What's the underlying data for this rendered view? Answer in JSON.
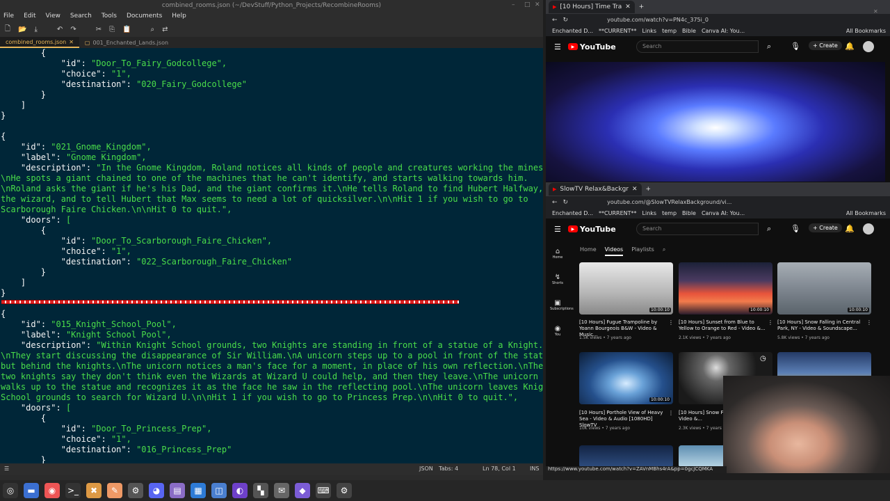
{
  "editor": {
    "title": "combined_rooms.json (~/DevStuff/Python_Projects/RecombineRooms)",
    "menu": [
      "File",
      "Edit",
      "View",
      "Search",
      "Tools",
      "Documents",
      "Help"
    ],
    "tabs": [
      {
        "label": "combined_rooms.json",
        "active": true
      },
      {
        "label": "001_Enchanted_Lands.json",
        "active": false
      }
    ],
    "code_lines": [
      "        {",
      "            \"id\": \"Door_To_Fairy_Godcollege\",",
      "            \"choice\": \"1\",",
      "            \"destination\": \"020_Fairy_Godcollege\"",
      "        }",
      "    ]",
      "}",
      "",
      "{",
      "    \"id\": \"021_Gnome_Kingdom\",",
      "    \"label\": \"Gnome Kingdom\",",
      "    \"description\": \"In the Gnome Kingdom, Roland notices all kinds of people and creatures working the mines.",
      "\\nHe spots a giant chained to one of the machines that he can't identify, and starts walking towards him.",
      "\\nRoland asks the giant if he's his Dad, and the giant confirms it.\\nHe tells Roland to find Hubert Halfway,",
      "the wizard, and to tell Hubert that Max seems to need a lot of quicksilver.\\n\\nHit 1 if you wish to go to",
      "Scarborough Faire Chicken.\\n\\nHit 0 to quit.\",",
      "    \"doors\": [",
      "        {",
      "            \"id\": \"Door_To_Scarborough_Faire_Chicken\",",
      "            \"choice\": \"1\",",
      "            \"destination\": \"022_Scarborough_Faire_Chicken\"",
      "        }",
      "    ]",
      "}",
      "",
      "{",
      "    \"id\": \"015_Knight_School_Pool\",",
      "    \"label\": \"Knight School Pool\",",
      "    \"description\": \"Within Knight School grounds, two Knights are standing in front of a statue of a Knight.",
      "\\nThey start discussing the disappearance of Sir William.\\nA unicorn steps up to a pool in front of the statue",
      "but behind the knights.\\nThe unicorn notices a man's face for a moment, in place of his own reflection.\\nThe",
      "two knights say they don't think even the Wizards at Wizard U could help, and then they leave.\\nThe unicorn",
      "walks up to the statue and recognizes it as the face he saw in the reflecting pool.\\nThe unicorn leaves Knight",
      "School grounds to search for Wizard U.\\n\\nHit 1 if you wish to go to Princess Prep.\\n\\nHit 0 to quit.\",",
      "    \"doors\": [",
      "        {",
      "            \"id\": \"Door_To_Princess_Prep\",",
      "            \"choice\": \"1\",",
      "            \"destination\": \"016_Princess_Prep\"",
      "        }"
    ],
    "status": {
      "lang": "JSON",
      "tabs": "Tabs: 4",
      "pos": "Ln 78, Col 1",
      "mode": "INS"
    }
  },
  "browser1": {
    "tab": "[10 Hours] Time Tra",
    "url": "youtube.com/watch?v=PN4c_375i_0",
    "bookmarks": [
      "Enchanted D...",
      "**CURRENT**",
      "Links",
      "temp",
      "Bible",
      "Canva AI: You...",
      "All Bookmarks"
    ],
    "logo": "YouTube",
    "search_placeholder": "Search",
    "create": "Create"
  },
  "browser2": {
    "tab": "SlowTV Relax&Backgr",
    "url": "youtube.com/@SlowTVRelaxBackground/vi...",
    "bookmarks": [
      "Enchanted D...",
      "**CURRENT**",
      "Links",
      "temp",
      "Bible",
      "Canva AI: You...",
      "All Bookmarks"
    ],
    "logo": "YouTube",
    "search_placeholder": "Search",
    "create": "Create",
    "sidebar": [
      "Home",
      "Shorts",
      "Subscriptions",
      "You"
    ],
    "channel_tabs": [
      "Home",
      "Videos",
      "Playlists"
    ],
    "videos": [
      {
        "title": "[10 Hours] Fugue Trampoline by Yoann Bourgeois B&W - Video & Music...",
        "meta": "1.5K views • 7 years ago",
        "duration": "10:00:10"
      },
      {
        "title": "[10 Hours] Sunset from Blue to Yellow to Orange to Red - Video &...",
        "meta": "2.1K views • 7 years ago",
        "duration": "10:00:10"
      },
      {
        "title": "[10 Hours] Snow Falling in Central Park, NY - Video & Soundscape...",
        "meta": "5.8K views • 7 years ago",
        "duration": "10:00:10"
      },
      {
        "title": "[10 Hours] Porthole View of Heavy Sea - Video & Audio [1080HD] SlowTV",
        "meta": "10K views • 7 years ago",
        "duration": "10:00:10"
      },
      {
        "title": "[10 Hours] Snow Fall Lamppost - Video &...",
        "meta": "2.3K views • 7 years ago",
        "duration": ""
      },
      {
        "title": "",
        "meta": "",
        "duration": ""
      }
    ],
    "status_url": "https://www.youtube.com/watch?v=ZAVnMBhs4rA&pp=0gcJCQMKA"
  }
}
